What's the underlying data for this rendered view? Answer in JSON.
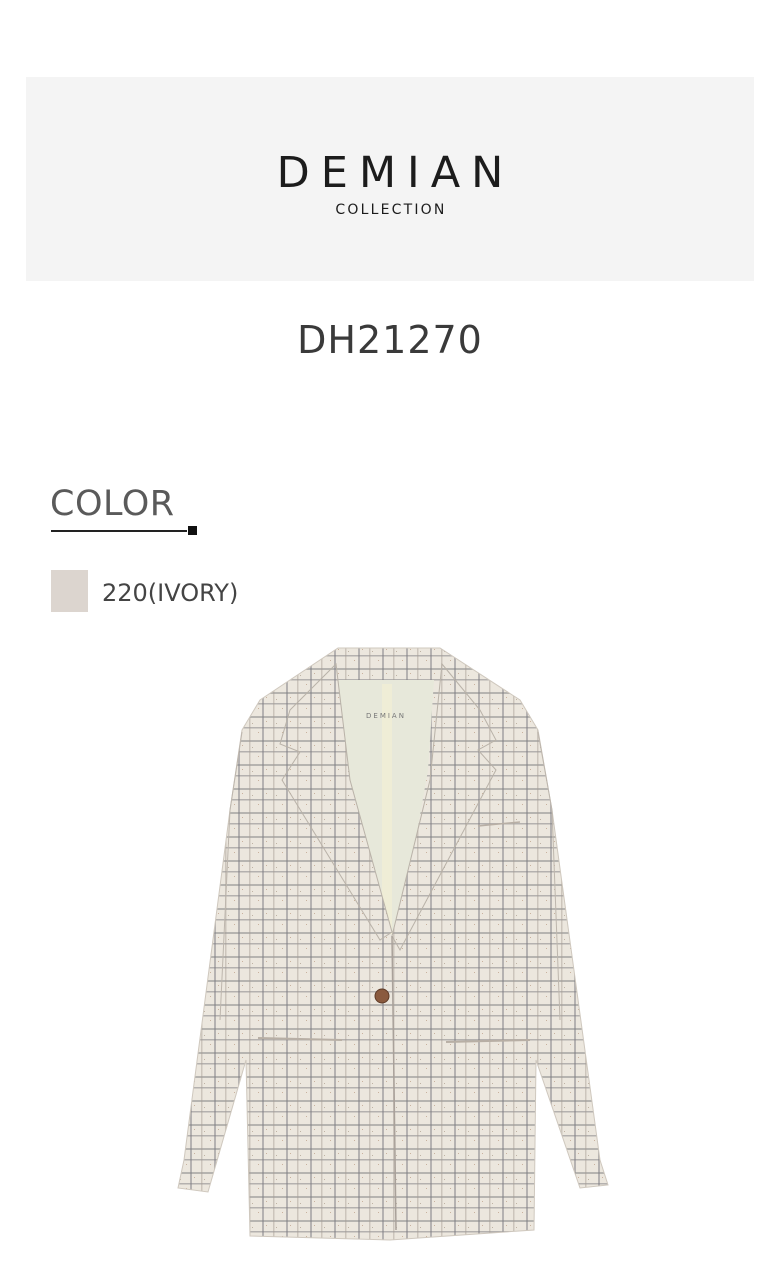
{
  "brand": {
    "name": "DEMIAN",
    "subtitle": "COLLECTION"
  },
  "product": {
    "code": "DH21270",
    "image_alt_icon": "tweed-jacket-image",
    "label_on_tag": "DEMIAN"
  },
  "color_section": {
    "heading": "COLOR",
    "options": [
      {
        "label": "220(IVORY)",
        "swatch_color": "#dcd5cf"
      }
    ]
  }
}
